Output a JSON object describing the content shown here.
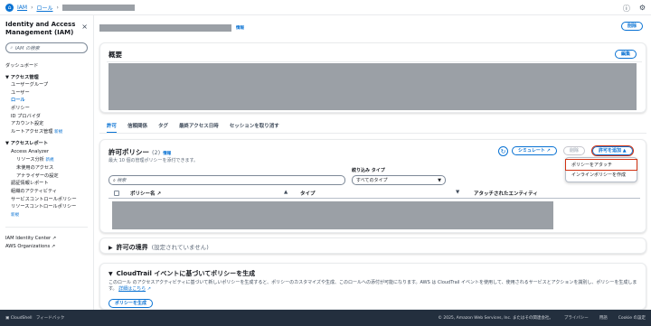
{
  "breadcrumb": {
    "iam": "IAM",
    "roles": "ロール"
  },
  "sidebar": {
    "title": "Identity and Access Management (IAM)",
    "search_placeholder": "IAM の検索",
    "dashboard": "ダッシュボード",
    "access_mgmt": "アクセス管理",
    "user_groups": "ユーザーグループ",
    "users": "ユーザー",
    "roles": "ロール",
    "policies": "ポリシー",
    "id_providers": "ID プロバイダ",
    "account_settings": "アカウント設定",
    "root_access": "ルートアクセス管理",
    "new": "新規",
    "access_reports": "アクセスレポート",
    "access_analyzer": "Access Analyzer",
    "resource_analysis": "リソース分析",
    "unused_access": "未使用のアクセス",
    "analyzer_settings": "アナライザーの設定",
    "credential_report": "認証情報レポート",
    "org_activity": "組織のアクティビティ",
    "scp": "サービスコントロールポリシー",
    "rcp": "リソースコントロールポリシー",
    "identity_center": "IAM Identity Center",
    "organizations": "AWS Organizations"
  },
  "header": {
    "info": "情報",
    "delete": "削除"
  },
  "summary": {
    "title": "概要",
    "edit": "編集"
  },
  "tabs": [
    "許可",
    "信頼関係",
    "タグ",
    "最終アクセス日時",
    "セッションを取り消す"
  ],
  "policies": {
    "title": "許可ポリシー",
    "count": "(2)",
    "info": "情報",
    "subtitle": "最大 10 個の管理ポリシーを添付できます。",
    "simulate": "シミュレート",
    "remove": "削除",
    "add": "許可を追加",
    "filter_label": "絞り込み タイプ",
    "search_placeholder": "検索",
    "type_select": "すべてのタイプ",
    "pagination": "1",
    "col_name": "ポリシー名",
    "col_type": "タイプ",
    "col_attached": "アタッチされたエンティティ"
  },
  "menu": {
    "attach": "ポリシーをアタッチ",
    "inline": "インラインポリシーを作成"
  },
  "boundary": {
    "title": "許可の境界",
    "subtitle": "(設定されていません)"
  },
  "cloudtrail": {
    "title": "CloudTrail イベントに基づいてポリシーを生成",
    "desc": "このロール のアクセスアクティビティに基づいて新しいポリシーを生成すると、ポリシーのカスタマイズや生成、このロールへの添付が可能になります。AWS は CloudTrail イベントを使用して、使用されるサービスとアクションを識別し、ポリシーを生成します。",
    "more": "詳細はこちら",
    "generate": "ポリシーを生成"
  },
  "footer": {
    "cloudshell": "CloudShell",
    "feedback": "フィードバック",
    "copyright": "© 2025, Amazon Web Services, Inc. またはその関連会社。",
    "privacy": "プライバシー",
    "terms": "用語",
    "cookies": "Cookie の設定"
  }
}
